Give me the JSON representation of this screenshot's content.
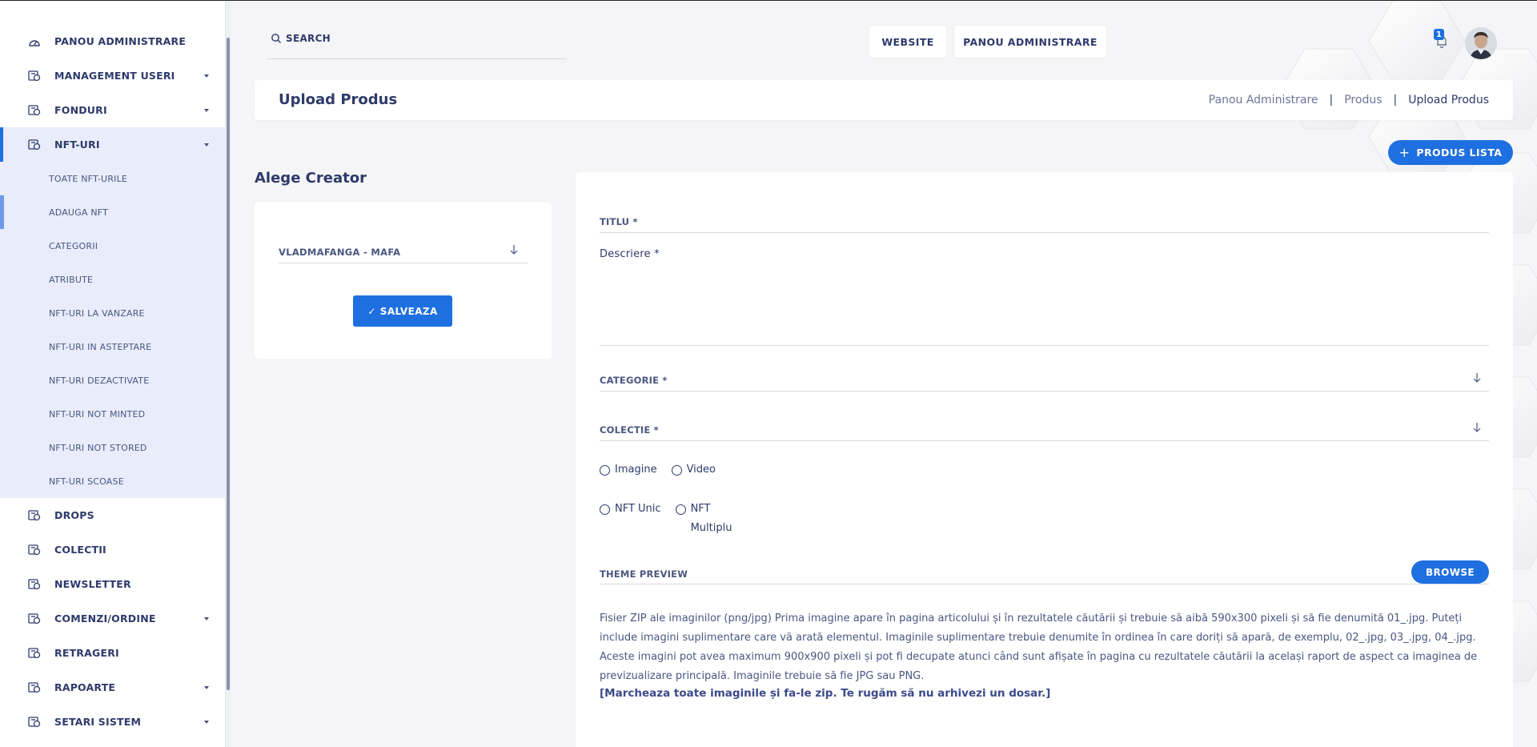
{
  "sidebar": {
    "items": [
      {
        "label": "PANOU ADMINISTRARE",
        "icon": "dashboard-icon",
        "chevron": false
      },
      {
        "label": "MANAGEMENT USERI",
        "icon": "module-icon",
        "chevron": true
      },
      {
        "label": "FONDURI",
        "icon": "module-icon",
        "chevron": true
      },
      {
        "label": "NFT-URI",
        "icon": "module-icon",
        "chevron": true,
        "active": true
      },
      {
        "label": "DROPS",
        "icon": "module-icon",
        "chevron": false
      },
      {
        "label": "COLECTII",
        "icon": "module-icon",
        "chevron": false
      },
      {
        "label": "NEWSLETTER",
        "icon": "module-icon",
        "chevron": false
      },
      {
        "label": "COMENZI/ORDINE",
        "icon": "module-icon",
        "chevron": true
      },
      {
        "label": "RETRAGERI",
        "icon": "module-icon",
        "chevron": false
      },
      {
        "label": "RAPOARTE",
        "icon": "module-icon",
        "chevron": true
      },
      {
        "label": "SETARI SISTEM",
        "icon": "module-icon",
        "chevron": true
      }
    ],
    "subitems": [
      {
        "label": "TOATE NFT-URILE"
      },
      {
        "label": "ADAUGA NFT",
        "active": true
      },
      {
        "label": "CATEGORII"
      },
      {
        "label": "ATRIBUTE"
      },
      {
        "label": "NFT-URI LA VANZARE"
      },
      {
        "label": "NFT-URI IN ASTEPTARE"
      },
      {
        "label": "NFT-URI DEZACTIVATE"
      },
      {
        "label": "NFT-URI NOT MINTED"
      },
      {
        "label": "NFT-URI NOT STORED"
      },
      {
        "label": "NFT-URI SCOASE"
      }
    ]
  },
  "topbar": {
    "search_placeholder": "SEARCH",
    "website_label": "WEBSITE",
    "admin_label": "PANOU ADMINISTRARE",
    "notification_count": "1"
  },
  "header": {
    "title": "Upload Produs",
    "breadcrumb": [
      "Panou Administrare",
      "Produs",
      "Upload Produs"
    ],
    "sep": "|"
  },
  "produs_lista_label": "PRODUS LISTA",
  "creator": {
    "title": "Alege Creator",
    "selected": "VLADMAFANGA - MAFA",
    "save_label": "SALVEAZA"
  },
  "form": {
    "titlu_label": "TITLU *",
    "descriere_label": "Descriere *",
    "categorie_label": "CATEGORIE *",
    "colectie_label": "COLECTIE *",
    "media_options": [
      "Imagine",
      "Video"
    ],
    "type_options": [
      "NFT Unic",
      "NFT Multiplu"
    ],
    "theme_preview_label": "THEME PREVIEW",
    "browse_label": "BROWSE",
    "help_text": "Fisier ZIP ale imaginilor (png/jpg) Prima imagine apare în pagina articolului și în rezultatele căutării și trebuie să aibă 590x300 pixeli și să fie denumită 01_.jpg. Puteți include imagini suplimentare care vă arată elementul. Imaginile suplimentare trebuie denumite în ordinea în care doriți să apară, de exemplu, 02_.jpg, 03_.jpg, 04_.jpg. Aceste imagini pot avea maximum 900x900 pixeli și pot fi decupate atunci când sunt afișate în pagina cu rezultatele căutării la același raport de aspect ca imaginea de previzualizare principală. Imaginile trebuie să fie JPG sau PNG.",
    "help_bold": "[Marcheaza toate imaginile și fa-le zip. Te rugăm să nu arhivezi un dosar.]"
  },
  "colors": {
    "accent": "#1e6fe0",
    "text": "#2e3a6b",
    "active_bg": "#e8ecfb"
  }
}
